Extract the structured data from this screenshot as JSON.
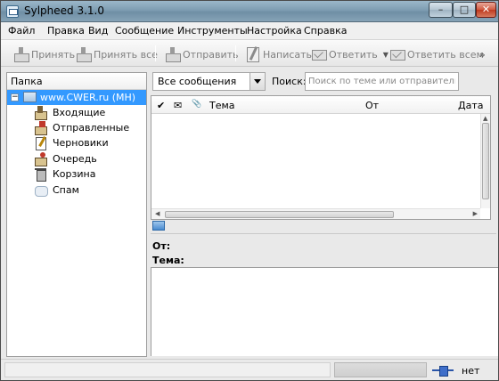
{
  "window": {
    "title": "Sylpheed 3.1.0"
  },
  "menu": [
    "Файл",
    "Правка",
    "Вид",
    "Сообщение",
    "Инструменты",
    "Настройка",
    "Справка"
  ],
  "toolbar": {
    "get": "Принять",
    "get_all": "Принять все",
    "send": "Отправить",
    "compose": "Написать",
    "reply": "Ответить",
    "reply_all": "Ответить всем",
    "more": "»"
  },
  "folder_pane": {
    "header": "Папка",
    "account": "www.CWER.ru (MH)",
    "toggle": "−",
    "folders": [
      "Входящие",
      "Отправленные",
      "Черновики",
      "Очередь",
      "Корзина",
      "Спам"
    ]
  },
  "filter": {
    "selected": "Все сообщения"
  },
  "search": {
    "label": "Поиск:",
    "placeholder": "Поиск по теме или отправителю"
  },
  "message_list": {
    "columns": {
      "mark": "✔",
      "unread": "✉",
      "attach": "📎",
      "subject": "Тема",
      "from": "От",
      "date": "Дата"
    }
  },
  "message_header": {
    "from": "От:",
    "subject": "Тема:"
  },
  "status": {
    "online": "нет"
  },
  "window_buttons": {
    "min": "–",
    "max": "□",
    "close": "✕"
  }
}
